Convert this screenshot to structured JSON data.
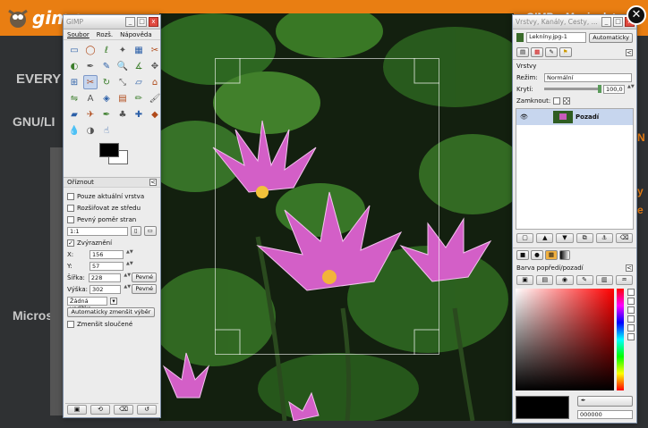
{
  "web": {
    "logo": "gimp",
    "left_texts": [
      "EVERY",
      "GNU/LI",
      "Microso"
    ],
    "top_right": "GIMP − Manipulat",
    "right_letters": [
      "N",
      "y",
      "e"
    ]
  },
  "toolbox": {
    "title": "GIMP",
    "menu": [
      "Soubor",
      "Rozš.",
      "Nápověda"
    ],
    "tools": [
      "rect-select",
      "ellipse-select",
      "free-select",
      "fuzzy-select",
      "by-color-select",
      "scissors",
      "foreground-select",
      "paths",
      "color-picker",
      "zoom",
      "measure",
      "move",
      "align",
      "crop",
      "rotate",
      "scale",
      "shear",
      "perspective",
      "flip",
      "text",
      "bucket-fill",
      "blend",
      "pencil",
      "paintbrush",
      "eraser",
      "airbrush",
      "ink",
      "clone",
      "heal",
      "perspective-clone",
      "blur",
      "dodge",
      "smudge"
    ],
    "selected_tool_index": 13,
    "options_title": "Oříznout",
    "only_current_layer": "Pouze aktuální vrstva",
    "expand_from_center": "Rozšiřovat ze středu",
    "fixed_aspect": "Pevný poměr stran",
    "aspect_value": "1:1",
    "highlight": "Zvýraznění",
    "x_label": "X:",
    "x_value": "156",
    "y_label": "Y:",
    "y_value": "57",
    "width_label": "Šířka:",
    "width_value": "228",
    "height_label": "Výška:",
    "height_value": "302",
    "fixed_button": "Pevné",
    "guides_value": "Žádná vodítka",
    "auto_shrink_button": "Automaticky zmenšit výběr",
    "shrink_merged": "Zmenšit sloučené"
  },
  "layers": {
    "title": "Vrstvy, Kanály, Cesty, ...",
    "image_select": "Lekníny.jpg-1",
    "auto_button": "Automaticky",
    "panel_label": "Vrstvy",
    "mode_label": "Režim:",
    "mode_value": "Normální",
    "opacity_label": "Krytí:",
    "opacity_value": "100,0",
    "opacity_percent": 1.0,
    "lock_label": "Zamknout:",
    "layer_name": "Pozadí",
    "colors_label": "Barva popředí/pozadí",
    "hex_value": "000000"
  },
  "colors": {
    "orange": "#e97e12",
    "fg": "#000000",
    "bg": "#ffffff"
  },
  "close_glyph": "✕"
}
